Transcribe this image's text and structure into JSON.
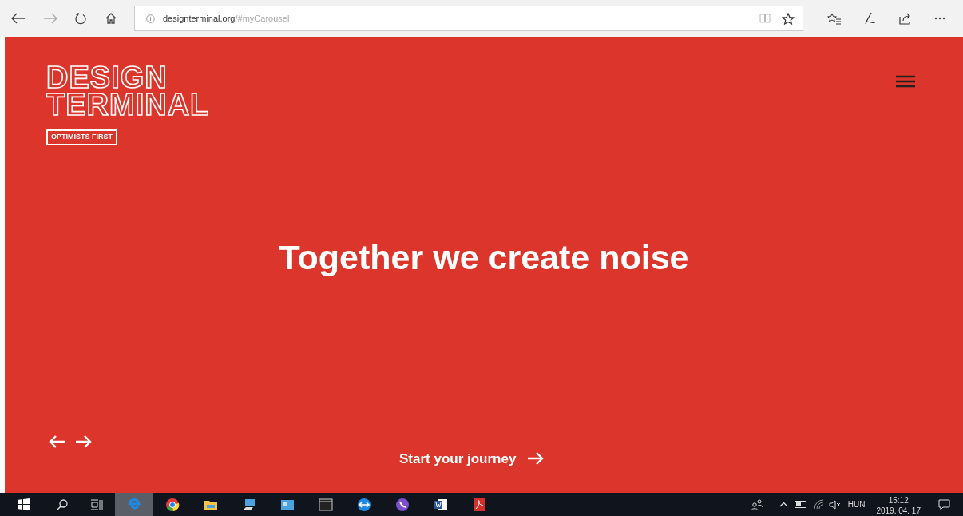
{
  "browser": {
    "url": {
      "domain": "designterminal.org",
      "path": "/#myCarousel"
    }
  },
  "hero": {
    "logo": [
      "DESIGN",
      "TERMINAL"
    ],
    "tagline": "OPTIMISTS FIRST",
    "headline": "Together we create noise",
    "cta": "Start your journey"
  },
  "taskbar": {
    "apps": [
      {
        "kind": "edge",
        "selected": true
      },
      {
        "kind": "chrome",
        "selected": false
      },
      {
        "kind": "folder",
        "selected": false
      },
      {
        "kind": "computer",
        "selected": false
      },
      {
        "kind": "window",
        "selected": false
      },
      {
        "kind": "terminal",
        "selected": false
      },
      {
        "kind": "teamviewer",
        "selected": false
      },
      {
        "kind": "viber",
        "selected": false
      },
      {
        "kind": "word",
        "selected": false
      },
      {
        "kind": "pdf",
        "selected": false
      }
    ],
    "language": "HUN",
    "time": "15:12",
    "date": "2019. 04. 17"
  }
}
